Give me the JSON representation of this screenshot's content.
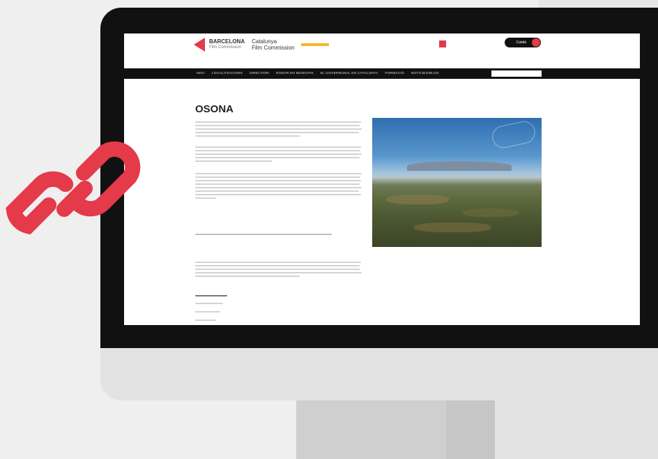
{
  "site": {
    "logo_line1": "BARCELONA",
    "logo_line2": "Film Commission",
    "logo_cat": "Catalunya",
    "logo_cat2": "Film Commission",
    "lang_label": "Català"
  },
  "top_links": [
    "",
    "",
    "",
    "",
    ""
  ],
  "nav": {
    "items": [
      "INICI",
      "LOCALITZACIONS",
      "DIRECTORI",
      "RODAR EN MÚNICPIS",
      "EL GOVERNUNAL EN CATALUNYA",
      "FORMACIÓ",
      "NOTÍCIES/BLOG"
    ]
  },
  "page": {
    "title": "OSONA",
    "section_label_1": "",
    "links_line": "",
    "section_label_2": "",
    "strong_label": "",
    "small_items": [
      "",
      "",
      ""
    ]
  },
  "colors": {
    "accent": "#e43a4a",
    "nav_bg": "#111111",
    "logo_yellow": "#f2b72b"
  },
  "icons": [
    "chain-link-icon",
    "search-icon"
  ]
}
